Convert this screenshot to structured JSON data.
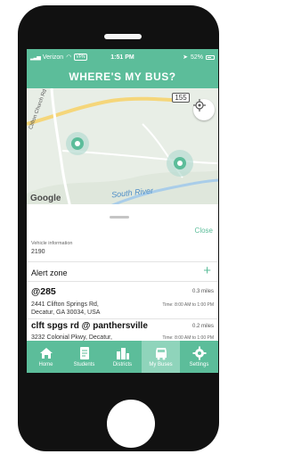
{
  "status_bar": {
    "carrier": "Verizon",
    "vpn": "VPN",
    "time": "1:51 PM",
    "battery": "52%"
  },
  "header": {
    "title": "WHERE'S MY BUS?"
  },
  "map": {
    "route_number": "155",
    "road_label": "Clifton Church Rd SE",
    "river_label": "South River",
    "provider_logo": "Google"
  },
  "sheet": {
    "close_label": "Close",
    "vehicle_label": "Vehicle information",
    "vehicle_value": "2190",
    "alert_zone_title": "Alert zone",
    "add_icon": "plus-icon"
  },
  "stops": [
    {
      "name": "@285",
      "distance": "0.3 miles",
      "address_line1": "2441 Clifton Springs Rd,",
      "address_line2": "Decatur, GA 30034, USA",
      "time": "Time: 8:00 AM to 1:00 PM"
    },
    {
      "name": "clft spgs rd @ panthersville",
      "distance": "0.2 miles",
      "address_line1": "3232 Colonial Pkwy, Decatur,",
      "address_line2": "",
      "time": "Time: 8:00 AM to 1:00 PM"
    }
  ],
  "tabs": [
    {
      "label": "Home",
      "icon": "home-icon"
    },
    {
      "label": "Students",
      "icon": "students-icon"
    },
    {
      "label": "Districts",
      "icon": "districts-icon"
    },
    {
      "label": "My Buses",
      "icon": "bus-icon",
      "active": true
    },
    {
      "label": "Settings",
      "icon": "gear-icon"
    }
  ],
  "colors": {
    "brand": "#5cbd9a",
    "active_tab": "#8fd4bb",
    "road": "#f5d67a",
    "river": "#a9cde9"
  }
}
